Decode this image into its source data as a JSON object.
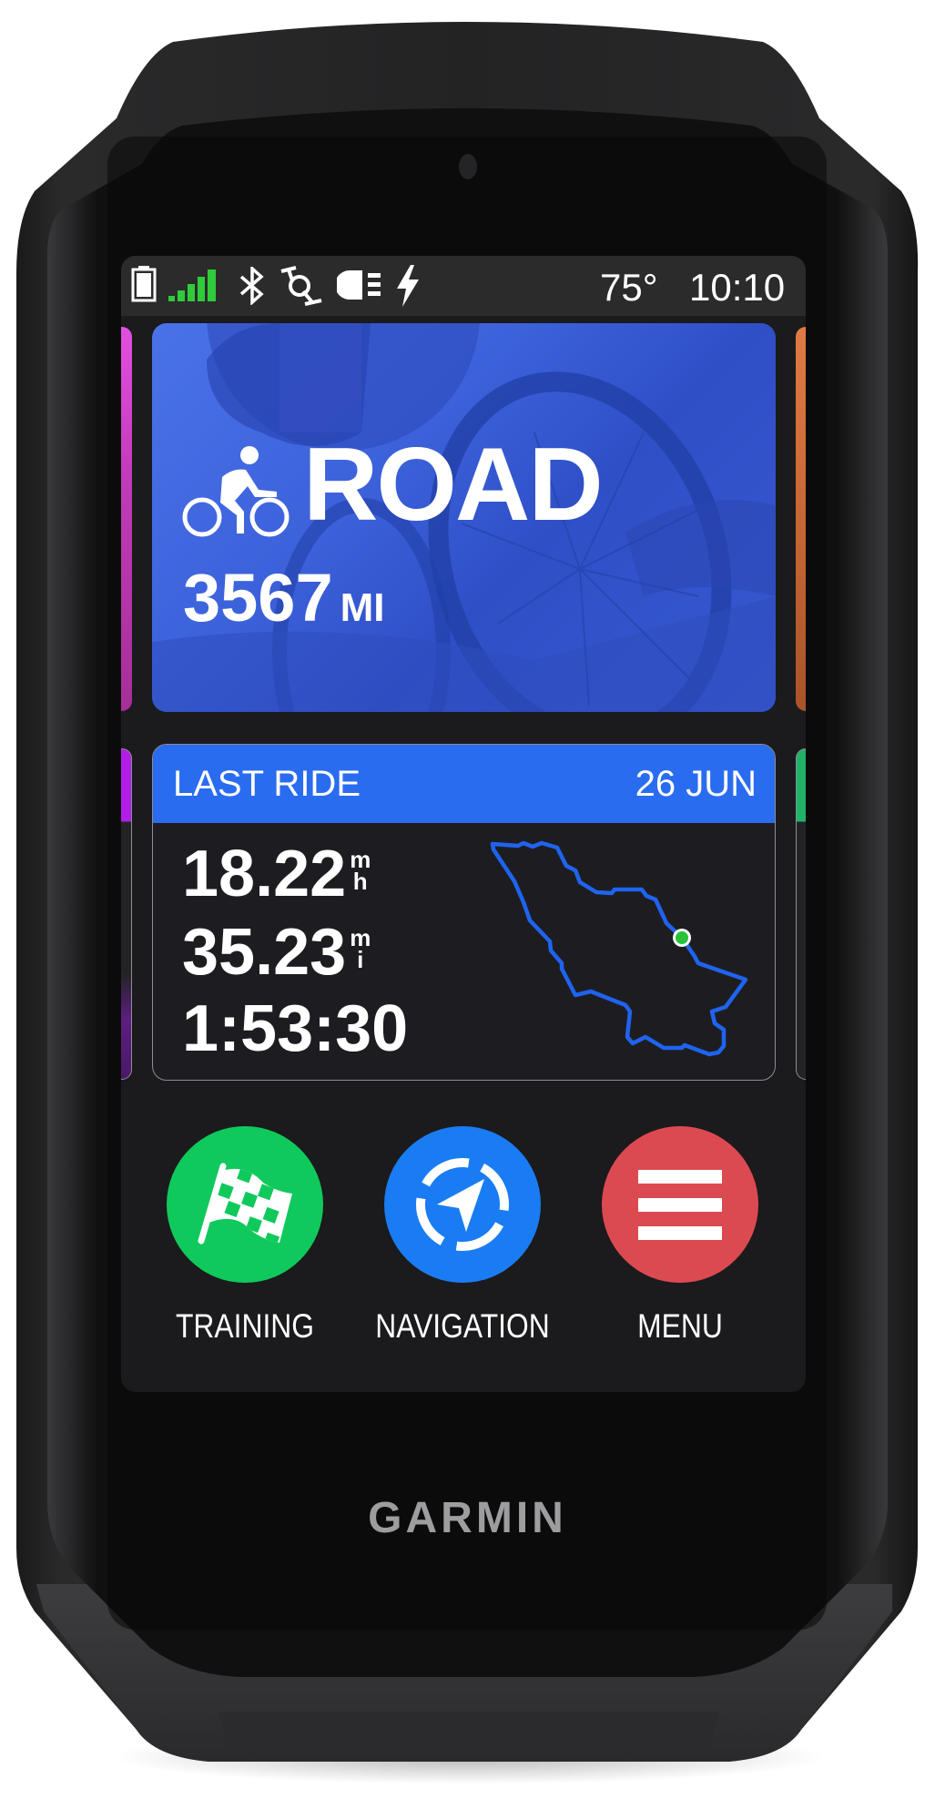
{
  "device": {
    "brand": "GARMIN"
  },
  "status_bar": {
    "icons": [
      "battery-icon",
      "signal-strength-icon",
      "bluetooth-icon",
      "sensor-icon",
      "bike-light-icon",
      "charging-bolt-icon"
    ],
    "signal_bars": 5,
    "temperature": "75°",
    "time": "10:10",
    "colors": {
      "signal": "#2fcb3a",
      "icon": "#ffffff"
    }
  },
  "profile_carousel": {
    "active_index": 0,
    "page_count": 6,
    "profile": {
      "icon": "cyclist-icon",
      "name": "ROAD",
      "distance_value": "3567",
      "distance_unit": "MI"
    },
    "peek_colors": {
      "left": "#d94ed8",
      "right": "#d4703d"
    },
    "accent": "#3f63dc"
  },
  "last_ride": {
    "title": "LAST RIDE",
    "date": "26 JUN",
    "stats": [
      {
        "value": "18.22",
        "unit_top": "m",
        "unit_bottom": "h"
      },
      {
        "value": "35.23",
        "unit_top": "m",
        "unit_bottom": "i"
      },
      {
        "value": "1:53:30",
        "unit_top": "",
        "unit_bottom": ""
      }
    ],
    "route_map": {
      "icon": "route-map-icon",
      "route_color": "#1f63f0",
      "marker_color": "#27c23a"
    },
    "header_color": "#2a6cf0",
    "peek_colors": {
      "left": "#b11ee8",
      "right": "#1fb36a"
    }
  },
  "actions": [
    {
      "label": "TRAINING",
      "icon": "checkered-flag-icon",
      "color": "#10c95c"
    },
    {
      "label": "NAVIGATION",
      "icon": "navigation-arrow-icon",
      "color": "#1a7cf2"
    },
    {
      "label": "MENU",
      "icon": "hamburger-menu-icon",
      "color": "#dc4a51"
    }
  ]
}
